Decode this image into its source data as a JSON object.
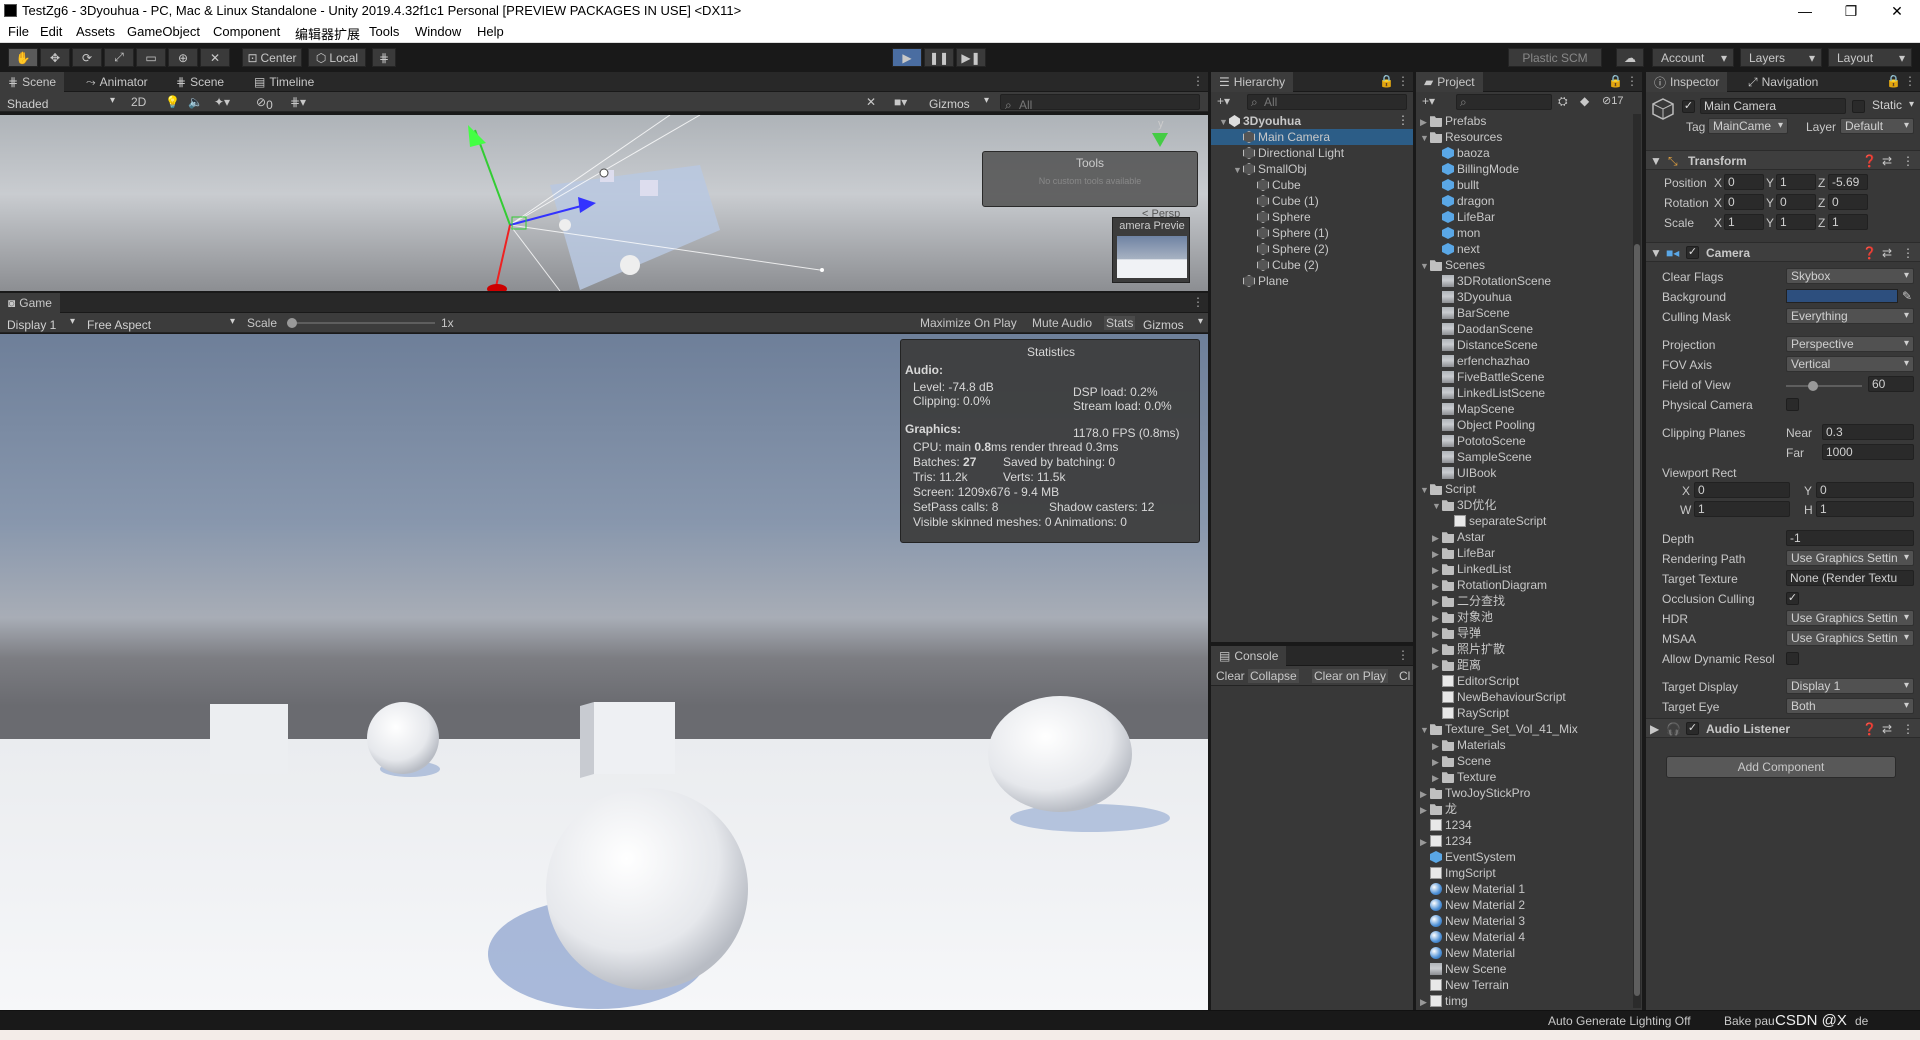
{
  "window": {
    "title": "TestZg6 - 3Dyouhua - PC, Mac & Linux Standalone - Unity 2019.4.32f1c1 Personal [PREVIEW PACKAGES IN USE] <DX11>"
  },
  "menu": [
    "File",
    "Edit",
    "Assets",
    "GameObject",
    "Component",
    "编辑器扩展",
    "Tools",
    "Window",
    "Help"
  ],
  "toolbar": {
    "center": "Center",
    "local": "Local",
    "plastic": "Plastic SCM",
    "account": "Account",
    "layers": "Layers",
    "layout": "Layout"
  },
  "scene_tabs": {
    "scene": "Scene",
    "animator": "Animator",
    "scene2": "Scene",
    "timeline": "Timeline"
  },
  "scene_bar": {
    "shaded": "Shaded",
    "twod": "2D",
    "fx_count": "0",
    "gizmos": "Gizmos",
    "search_placeholder": "All"
  },
  "scene_overlay": {
    "tools_title": "Tools",
    "tools_sub": "No custom tools available",
    "persp": "< Persp",
    "camera_preview": "amera Previe",
    "axis_y": "y"
  },
  "game": {
    "tab": "Game",
    "display": "Display 1",
    "aspect": "Free Aspect",
    "scale_label": "Scale",
    "scale_value": "1x",
    "scale_fraction": 0.0,
    "maximize": "Maximize On Play",
    "mute": "Mute Audio",
    "stats": "Stats",
    "gizmos": "Gizmos"
  },
  "statistics": {
    "title": "Statistics",
    "audio": "Audio:",
    "level": "Level: -74.8 dB",
    "clipping": "Clipping: 0.0%",
    "dsp": "DSP load: 0.2%",
    "stream": "Stream load: 0.0%",
    "graphics": "Graphics:",
    "fps": "1178.0 FPS (0.8ms)",
    "cpu_a": "CPU: main ",
    "cpu_b": "0.8",
    "cpu_c": "ms  render thread 0.3ms",
    "batches_a": "Batches: ",
    "batches_b": "27",
    "saved": "Saved by batching: 0",
    "tris": "Tris: 11.2k",
    "verts": "Verts: 11.5k",
    "screen": "Screen: 1209x676 - 9.4 MB",
    "setpass": "SetPass calls: 8",
    "shadow": "Shadow casters: 12",
    "skinned": "Visible skinned meshes: 0  Animations: 0"
  },
  "hierarchy": {
    "tab": "Hierarchy",
    "search_placeholder": "All",
    "items": [
      {
        "label": "3Dyouhua",
        "depth": 0,
        "icon": "unity",
        "open": true,
        "bold": true
      },
      {
        "label": "Main Camera",
        "depth": 1,
        "icon": "go"
      },
      {
        "label": "Directional Light",
        "depth": 1,
        "icon": "go"
      },
      {
        "label": "SmallObj",
        "depth": 1,
        "icon": "go",
        "open": true
      },
      {
        "label": "Cube",
        "depth": 2,
        "icon": "go"
      },
      {
        "label": "Cube (1)",
        "depth": 2,
        "icon": "go"
      },
      {
        "label": "Sphere",
        "depth": 2,
        "icon": "go"
      },
      {
        "label": "Sphere (1)",
        "depth": 2,
        "icon": "go"
      },
      {
        "label": "Sphere (2)",
        "depth": 2,
        "icon": "go"
      },
      {
        "label": "Cube (2)",
        "depth": 2,
        "icon": "go"
      },
      {
        "label": "Plane",
        "depth": 1,
        "icon": "go"
      }
    ]
  },
  "console": {
    "tab": "Console",
    "clear": "Clear",
    "collapse": "Collapse",
    "clear_on_play": "Clear on Play",
    "cl": "Cl"
  },
  "project": {
    "tab": "Project",
    "count": "17",
    "items": [
      {
        "label": "Prefabs",
        "depth": 0,
        "icon": "folder",
        "arrow": "▶"
      },
      {
        "label": "Resources",
        "depth": 0,
        "icon": "folder",
        "arrow": "▼"
      },
      {
        "label": "baoza",
        "depth": 1,
        "icon": "cube"
      },
      {
        "label": "BillingMode",
        "depth": 1,
        "icon": "cube"
      },
      {
        "label": "bullt",
        "depth": 1,
        "icon": "cube"
      },
      {
        "label": "dragon",
        "depth": 1,
        "icon": "cube"
      },
      {
        "label": "LifeBar",
        "depth": 1,
        "icon": "cube"
      },
      {
        "label": "mon",
        "depth": 1,
        "icon": "cube"
      },
      {
        "label": "next",
        "depth": 1,
        "icon": "cube"
      },
      {
        "label": "Scenes",
        "depth": 0,
        "icon": "folder",
        "arrow": "▼"
      },
      {
        "label": "3DRotationScene",
        "depth": 1,
        "icon": "scene"
      },
      {
        "label": "3Dyouhua",
        "depth": 1,
        "icon": "scene"
      },
      {
        "label": "BarScene",
        "depth": 1,
        "icon": "scene"
      },
      {
        "label": "DaodanScene",
        "depth": 1,
        "icon": "scene"
      },
      {
        "label": "DistanceScene",
        "depth": 1,
        "icon": "scene"
      },
      {
        "label": "erfenchazhao",
        "depth": 1,
        "icon": "scene"
      },
      {
        "label": "FiveBattleScene",
        "depth": 1,
        "icon": "scene"
      },
      {
        "label": "LinkedListScene",
        "depth": 1,
        "icon": "scene"
      },
      {
        "label": "MapScene",
        "depth": 1,
        "icon": "scene"
      },
      {
        "label": "Object Pooling",
        "depth": 1,
        "icon": "scene"
      },
      {
        "label": "PototoScene",
        "depth": 1,
        "icon": "scene"
      },
      {
        "label": "SampleScene",
        "depth": 1,
        "icon": "scene"
      },
      {
        "label": "UIBook",
        "depth": 1,
        "icon": "scene"
      },
      {
        "label": "Script",
        "depth": 0,
        "icon": "folder",
        "arrow": "▼"
      },
      {
        "label": "3D优化",
        "depth": 1,
        "icon": "folder",
        "arrow": "▼"
      },
      {
        "label": "separateScript",
        "depth": 2,
        "icon": "script"
      },
      {
        "label": "Astar",
        "depth": 1,
        "icon": "folder",
        "arrow": "▶"
      },
      {
        "label": "LifeBar",
        "depth": 1,
        "icon": "folder",
        "arrow": "▶"
      },
      {
        "label": "LinkedList",
        "depth": 1,
        "icon": "folder",
        "arrow": "▶"
      },
      {
        "label": "RotationDiagram",
        "depth": 1,
        "icon": "folder",
        "arrow": "▶"
      },
      {
        "label": "二分查找",
        "depth": 1,
        "icon": "folder",
        "arrow": "▶"
      },
      {
        "label": "对象池",
        "depth": 1,
        "icon": "folder",
        "arrow": "▶"
      },
      {
        "label": "导弹",
        "depth": 1,
        "icon": "folder",
        "arrow": "▶"
      },
      {
        "label": "照片扩散",
        "depth": 1,
        "icon": "folder",
        "arrow": "▶"
      },
      {
        "label": "距离",
        "depth": 1,
        "icon": "folder",
        "arrow": "▶"
      },
      {
        "label": "EditorScript",
        "depth": 1,
        "icon": "script"
      },
      {
        "label": "NewBehaviourScript",
        "depth": 1,
        "icon": "script"
      },
      {
        "label": "RayScript",
        "depth": 1,
        "icon": "script"
      },
      {
        "label": "Texture_Set_Vol_41_Mix",
        "depth": 0,
        "icon": "folder",
        "arrow": "▼"
      },
      {
        "label": "Materials",
        "depth": 1,
        "icon": "folder",
        "arrow": "▶"
      },
      {
        "label": "Scene",
        "depth": 1,
        "icon": "folder",
        "arrow": "▶"
      },
      {
        "label": "Texture",
        "depth": 1,
        "icon": "folder",
        "arrow": "▶"
      },
      {
        "label": "TwoJoyStickPro",
        "depth": 0,
        "icon": "folder",
        "arrow": "▶"
      },
      {
        "label": "龙",
        "depth": 0,
        "icon": "folder",
        "arrow": "▶"
      },
      {
        "label": "1234",
        "depth": 0,
        "icon": "script"
      },
      {
        "label": "1234",
        "depth": 0,
        "icon": "script",
        "arrow": "▶"
      },
      {
        "label": "EventSystem",
        "depth": 0,
        "icon": "cube"
      },
      {
        "label": "ImgScript",
        "depth": 0,
        "icon": "script"
      },
      {
        "label": "New Material 1",
        "depth": 0,
        "icon": "mat"
      },
      {
        "label": "New Material 2",
        "depth": 0,
        "icon": "mat"
      },
      {
        "label": "New Material 3",
        "depth": 0,
        "icon": "mat"
      },
      {
        "label": "New Material 4",
        "depth": 0,
        "icon": "mat"
      },
      {
        "label": "New Material",
        "depth": 0,
        "icon": "mat"
      },
      {
        "label": "New Scene",
        "depth": 0,
        "icon": "scene"
      },
      {
        "label": "New Terrain",
        "depth": 0,
        "icon": "script"
      },
      {
        "label": "timg",
        "depth": 0,
        "icon": "script",
        "arrow": "▶"
      }
    ]
  },
  "inspector": {
    "tab": "Inspector",
    "nav_tab": "Navigation",
    "object_name": "Main Camera",
    "static": "Static",
    "tag_label": "Tag",
    "tag": "MainCame",
    "layer_label": "Layer",
    "layer": "Default",
    "transform": {
      "title": "Transform",
      "position": "Position",
      "rotation": "Rotation",
      "scale": "Scale",
      "x": "X",
      "y": "Y",
      "z": "Z",
      "pos": [
        "0",
        "1",
        "-5.69"
      ],
      "rot": [
        "0",
        "0",
        "0"
      ],
      "scl": [
        "1",
        "1",
        "1"
      ]
    },
    "camera": {
      "title": "Camera",
      "clear_flags": "Clear Flags",
      "clear_flags_v": "Skybox",
      "background": "Background",
      "background_color": "#2d4f7e",
      "culling_mask": "Culling Mask",
      "culling_mask_v": "Everything",
      "projection": "Projection",
      "projection_v": "Perspective",
      "fov_axis": "FOV Axis",
      "fov_axis_v": "Vertical",
      "fov": "Field of View",
      "fov_v": "60",
      "fov_fraction": 0.34,
      "physical": "Physical Camera",
      "clipping": "Clipping Planes",
      "near": "Near",
      "near_v": "0.3",
      "far": "Far",
      "far_v": "1000",
      "viewport": "Viewport Rect",
      "vx": "X",
      "vx_v": "0",
      "vy": "Y",
      "vy_v": "0",
      "vw": "W",
      "vw_v": "1",
      "vh": "H",
      "vh_v": "1",
      "depth": "Depth",
      "depth_v": "-1",
      "rendering_path": "Rendering Path",
      "rendering_path_v": "Use Graphics Settin",
      "target_texture": "Target Texture",
      "target_texture_v": "None (Render Textu",
      "occlusion": "Occlusion Culling",
      "hdr": "HDR",
      "hdr_v": "Use Graphics Settin",
      "msaa": "MSAA",
      "msaa_v": "Use Graphics Settin",
      "dynres": "Allow Dynamic Resol",
      "target_display": "Target Display",
      "target_display_v": "Display 1",
      "target_eye": "Target Eye",
      "target_eye_v": "Both"
    },
    "audio": {
      "title": "Audio Listener"
    },
    "add_component": "Add Component"
  },
  "status": {
    "auto_lighting": "Auto Generate Lighting Off",
    "bake": "Bake pau",
    "watermark": "CSDN @X",
    "bake_tail": "de"
  }
}
